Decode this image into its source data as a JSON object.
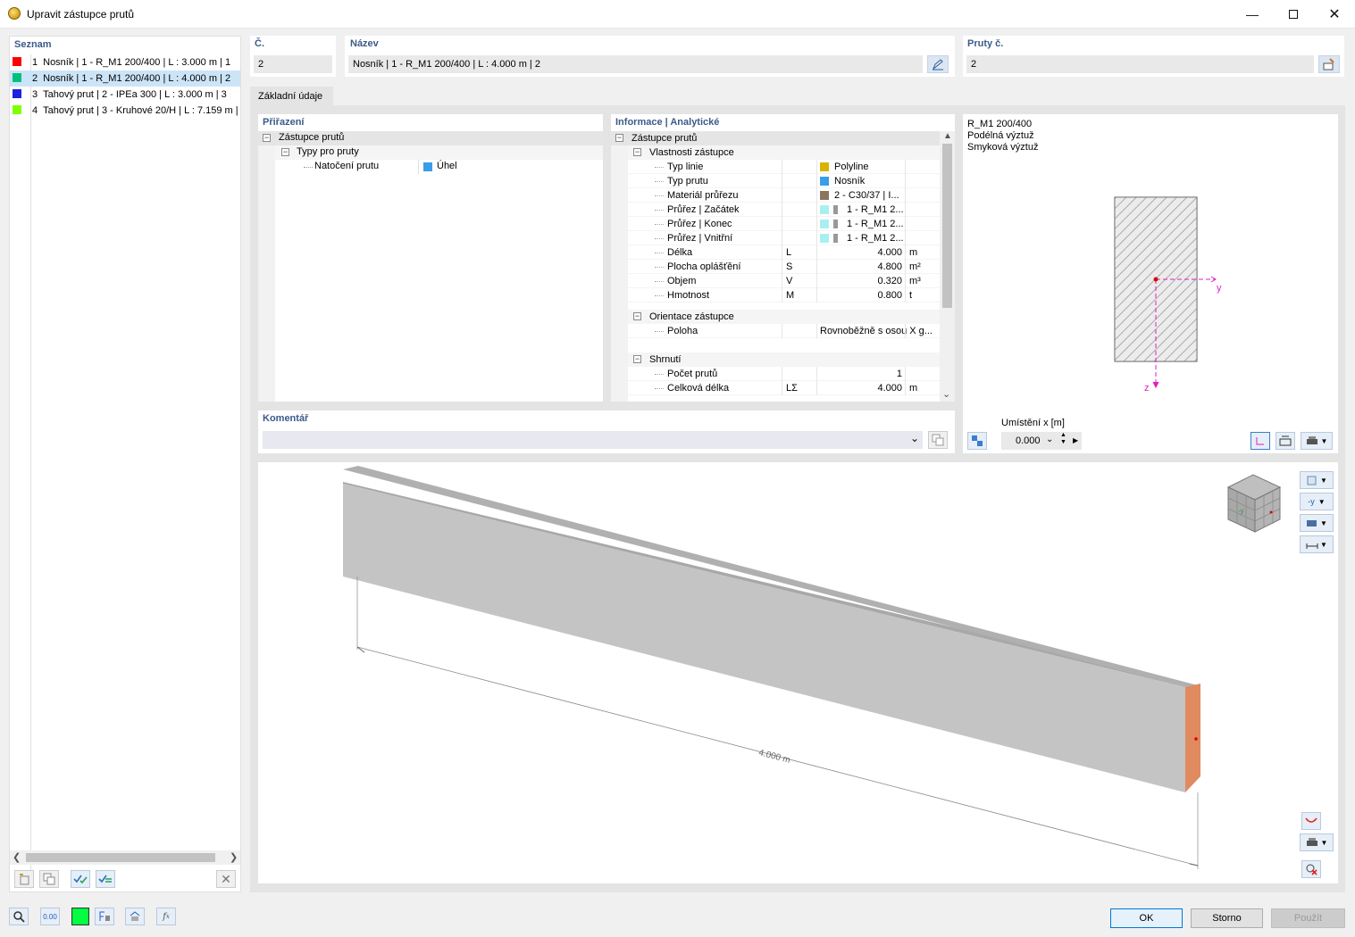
{
  "window": {
    "title": "Upravit zástupce prutů"
  },
  "list": {
    "header": "Seznam",
    "items": [
      {
        "no": "1",
        "label": "Nosník | 1 - R_M1 200/400 | L : 3.000 m | 1",
        "color": "#ff0000"
      },
      {
        "no": "2",
        "label": "Nosník | 1 - R_M1 200/400 | L : 4.000 m | 2",
        "color": "#00c080"
      },
      {
        "no": "3",
        "label": "Tahový prut | 2 - IPEa 300 | L : 3.000 m | 3",
        "color": "#2020e0"
      },
      {
        "no": "4",
        "label": "Tahový prut | 3 - Kruhové 20/H | L : 7.159 m |",
        "color": "#80ff00"
      }
    ]
  },
  "fields": {
    "no_label": "Č.",
    "no_value": "2",
    "name_label": "Název",
    "name_value": "Nosník | 1 - R_M1 200/400 | L : 4.000 m | 2",
    "members_label": "Pruty č.",
    "members_value": "2"
  },
  "tab": {
    "label": "Základní údaje"
  },
  "assign": {
    "header": "Přiřazení",
    "root": "Zástupce prutů",
    "child": "Typy pro pruty",
    "leaf_label": "Natočení prutu",
    "leaf_value": "Úhel"
  },
  "info": {
    "header": "Informace | Analytické",
    "root": "Zástupce prutů",
    "groups": [
      {
        "title": "Vlastnosti zástupce",
        "rows": [
          {
            "label": "Typ linie",
            "sym": "",
            "value": "Polyline",
            "unit": "",
            "swatch": "#d8b400"
          },
          {
            "label": "Typ prutu",
            "sym": "",
            "value": "Nosník",
            "unit": "",
            "swatch": "#3a9de8"
          },
          {
            "label": "Materiál průřezu",
            "sym": "",
            "value": "2 - C30/37 | I...",
            "unit": "",
            "swatch": "#8b7560"
          },
          {
            "label": "Průřez | Začátek",
            "sym": "",
            "value": "1 - R_M1 2...",
            "unit": "",
            "swatch": "#a8f0f0"
          },
          {
            "label": "Průřez | Konec",
            "sym": "",
            "value": "1 - R_M1 2...",
            "unit": "",
            "swatch": "#a8f0f0"
          },
          {
            "label": "Průřez | Vnitřní",
            "sym": "",
            "value": "1 - R_M1 2...",
            "unit": "",
            "swatch": "#a8f0f0"
          },
          {
            "label": "Délka",
            "sym": "L",
            "value": "4.000",
            "unit": "m",
            "swatch": ""
          },
          {
            "label": "Plocha oplášťění",
            "sym": "S",
            "value": "4.800",
            "unit": "m²",
            "swatch": ""
          },
          {
            "label": "Objem",
            "sym": "V",
            "value": "0.320",
            "unit": "m³",
            "swatch": ""
          },
          {
            "label": "Hmotnost",
            "sym": "M",
            "value": "0.800",
            "unit": "t",
            "swatch": ""
          }
        ]
      },
      {
        "title": "Orientace zástupce",
        "rows": [
          {
            "label": "Poloha",
            "sym": "",
            "value": "Rovnoběžně s osou X g...",
            "unit": "",
            "swatch": ""
          }
        ]
      },
      {
        "title": "Shrnutí",
        "rows": [
          {
            "label": "Počet prutů",
            "sym": "",
            "value": "1",
            "unit": "",
            "swatch": ""
          },
          {
            "label": "Celková délka",
            "sym": "LΣ",
            "value": "4.000",
            "unit": "m",
            "swatch": ""
          }
        ]
      }
    ]
  },
  "comment": {
    "header": "Komentář",
    "value": ""
  },
  "section": {
    "lines": [
      "R_M1 200/400",
      "Podélná výztuž",
      "Smyková výztuž"
    ],
    "axis_y": "y",
    "axis_z": "z",
    "position_label": "Umístění x [m]",
    "position_value": "0.000"
  },
  "view3d": {
    "dimension_label": "4.000 m",
    "cube_y": "-y",
    "axis_btn_label": "-y"
  },
  "footer": {
    "ok": "OK",
    "cancel": "Storno",
    "apply": "Použít",
    "value_icon_label": "0.00"
  },
  "colors": {
    "accent": "#3c5a8a",
    "beam": "#c0c0c0",
    "beam_end": "#e08a60",
    "selected": "#cce4f7"
  }
}
